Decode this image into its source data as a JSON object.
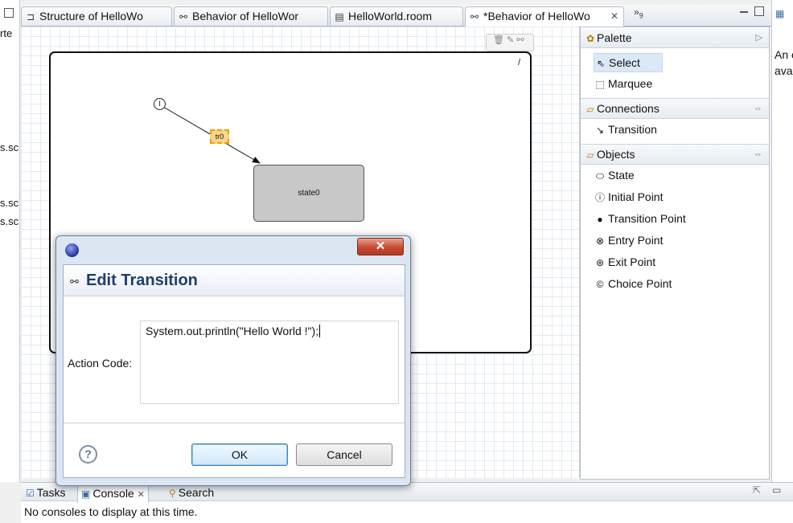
{
  "left_panel": {
    "fragments": [
      "rte",
      "s.sc",
      "s.sc",
      "s.sc"
    ]
  },
  "tabs": [
    {
      "label": "Structure of HelloWo",
      "icon": "structure-icon"
    },
    {
      "label": "Behavior of HelloWor",
      "icon": "behavior-icon"
    },
    {
      "label": "HelloWorld.room",
      "icon": "file-icon"
    },
    {
      "label": "*Behavior of HelloWo",
      "icon": "behavior-icon",
      "active": true
    }
  ],
  "overflow_tabs": {
    "glyph": "»",
    "count": "9"
  },
  "diagram": {
    "state_label": "state0",
    "transition_label": "tr0",
    "corner_mark": "/"
  },
  "palette": {
    "title": "Palette",
    "tools": [
      {
        "label": "Select",
        "icon": "arrow-cursor-icon",
        "selected": true
      },
      {
        "label": "Marquee",
        "icon": "marquee-icon"
      }
    ],
    "sections": [
      {
        "title": "Connections",
        "items": [
          {
            "label": "Transition",
            "icon": "transition-icon"
          }
        ]
      },
      {
        "title": "Objects",
        "items": [
          {
            "label": "State",
            "icon": "state-icon"
          },
          {
            "label": "Initial Point",
            "icon": "initial-point-icon"
          },
          {
            "label": "Transition Point",
            "icon": "transition-point-icon"
          },
          {
            "label": "Entry Point",
            "icon": "entry-point-icon"
          },
          {
            "label": "Exit Point",
            "icon": "exit-point-icon"
          },
          {
            "label": "Choice Point",
            "icon": "choice-point-icon"
          }
        ]
      }
    ]
  },
  "outline_panel": {
    "lines": [
      "An c",
      "ava"
    ]
  },
  "console": {
    "tabs": [
      {
        "label": "Tasks"
      },
      {
        "label": "Console",
        "active": true
      },
      {
        "label": "Search"
      }
    ],
    "message": "No consoles to display at this time."
  },
  "dialog": {
    "title": "Edit Transition",
    "close_glyph": "✕",
    "action_code_label": "Action Code:",
    "action_code_value": "System.out.println(\"Hello World !\");",
    "help_glyph": "?",
    "ok_label": "OK",
    "cancel_label": "Cancel"
  }
}
